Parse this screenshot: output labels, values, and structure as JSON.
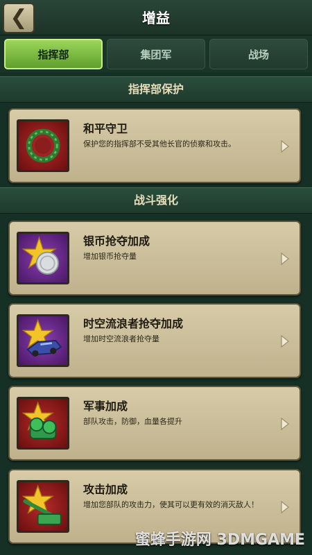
{
  "header": {
    "title": "增益",
    "back_icon": "chevron-left-icon"
  },
  "tabs": [
    {
      "label": "指挥部",
      "active": true
    },
    {
      "label": "集团军",
      "active": false
    },
    {
      "label": "战场",
      "active": false
    }
  ],
  "sections": [
    {
      "title": "指挥部保护",
      "cards": [
        {
          "title": "和平守卫",
          "desc": "保护您的指挥部不受其他长官的侦察和攻击。",
          "icon": "laurel-wreath-icon"
        }
      ]
    },
    {
      "title": "战斗强化",
      "cards": [
        {
          "title": "银币抢夺加成",
          "desc": "增加银币抢夺量",
          "icon": "silver-coin-star-icon"
        },
        {
          "title": "时空流浪者抢夺加成",
          "desc": "增加时空流浪者抢夺量",
          "icon": "vehicle-star-icon"
        },
        {
          "title": "军事加成",
          "desc": "部队攻击，防御，血量各提升",
          "icon": "cannon-star-icon"
        },
        {
          "title": "攻击加成",
          "desc": "增加您部队的攻击力，使其可以更有效的消灭敌人！",
          "icon": "artillery-star-icon"
        }
      ]
    }
  ],
  "colors": {
    "tab_active": "#7cc043",
    "background": "#163026",
    "card": "#cfc29c"
  },
  "watermark": "蜜蜂手游网 3DMGAME"
}
